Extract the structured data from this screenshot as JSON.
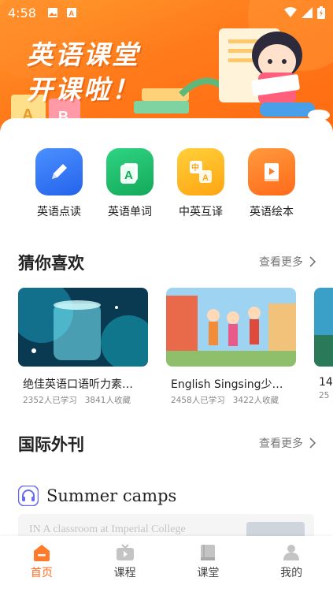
{
  "status_bar": {
    "time": "4:58"
  },
  "banner": {
    "line1": "英语课堂",
    "line2": "开课啦！"
  },
  "quick_actions": [
    {
      "label": "英语点读",
      "icon": "pencil-icon",
      "color": "#2f7bf5"
    },
    {
      "label": "英语单词",
      "icon": "letter-a-card-icon",
      "color": "#1fbf6a"
    },
    {
      "label": "中英互译",
      "icon": "translate-icon",
      "color": "#ffb21e"
    },
    {
      "label": "英语绘本",
      "icon": "picture-book-icon",
      "color": "#ff7a2a"
    }
  ],
  "guess_section": {
    "title": "猜你喜欢",
    "more": "查看更多"
  },
  "courses": [
    {
      "title": "绝佳英语口语听力素…",
      "learners": "2352人已学习",
      "favorites": "3841人收藏"
    },
    {
      "title": "English Singsing少儿…",
      "learners": "2458人已学习",
      "favorites": "3422人收藏"
    },
    {
      "title": "14",
      "learners": "25",
      "favorites": ""
    }
  ],
  "journal_section": {
    "title": "国际外刊",
    "more": "查看更多"
  },
  "article": {
    "title": "Summer camps",
    "preview": "IN A classroom at Imperial College"
  },
  "tabbar": [
    {
      "label": "首页",
      "icon": "home-icon",
      "active": true
    },
    {
      "label": "课程",
      "icon": "tv-icon",
      "active": false
    },
    {
      "label": "课堂",
      "icon": "book-icon",
      "active": false
    },
    {
      "label": "我的",
      "icon": "user-icon",
      "active": false
    }
  ],
  "colors": {
    "accent": "#ff6b1c",
    "banner": "#ff8322"
  }
}
